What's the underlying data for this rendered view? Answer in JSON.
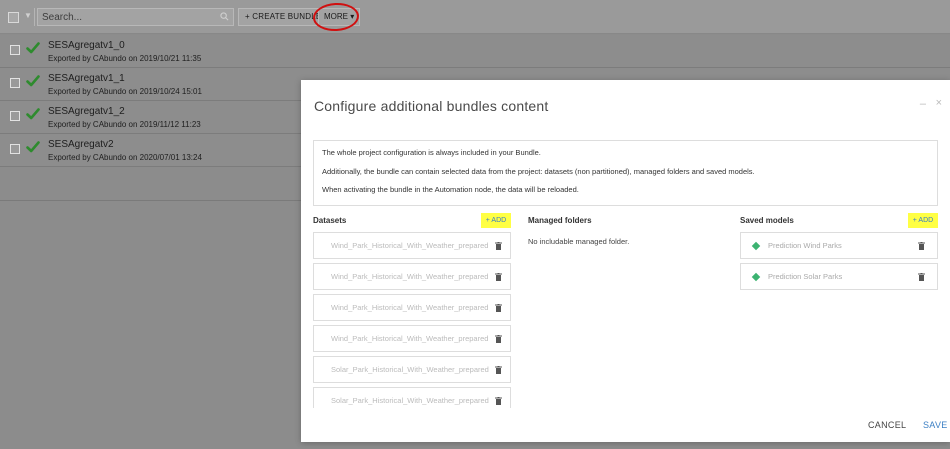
{
  "toolbar": {
    "search_placeholder": "Search...",
    "create_bundle_label": "+ CREATE BUNDLE",
    "more_label": "MORE ▾"
  },
  "bundles": [
    {
      "name": "SESAgregatv1_0",
      "exported": "Exported by CAbundo on 2019/10/21 11:35"
    },
    {
      "name": "SESAgregatv1_1",
      "exported": "Exported by CAbundo on 2019/10/24 15:01"
    },
    {
      "name": "SESAgregatv1_2",
      "exported": "Exported by CAbundo on 2019/11/12 11:23"
    },
    {
      "name": "SESAgregatv2",
      "exported": "Exported by CAbundo on 2020/07/01 13:24"
    }
  ],
  "modal": {
    "title": "Configure additional bundles content",
    "minimize": "–",
    "close": "×",
    "info": [
      "The whole project configuration is always included in your Bundle.",
      "Additionally, the bundle can contain selected data from the project: datasets (non partitioned), managed folders and saved models.",
      "When activating the bundle in the Automation node, the data will be reloaded."
    ],
    "datasets": {
      "header": "Datasets",
      "add_label": "+ ADD",
      "items": [
        "Wind_Park_Historical_With_Weather_prepared",
        "Wind_Park_Historical_With_Weather_prepared",
        "Wind_Park_Historical_With_Weather_prepared",
        "Wind_Park_Historical_With_Weather_prepared",
        "Solar_Park_Historical_With_Weather_prepared",
        "Solar_Park_Historical_With_Weather_prepared"
      ]
    },
    "managed_folders": {
      "header": "Managed folders",
      "empty_text": "No includable managed folder."
    },
    "saved_models": {
      "header": "Saved models",
      "add_label": "+ ADD",
      "items": [
        "Prediction Wind Parks",
        "Prediction Solar Parks"
      ]
    },
    "cancel_label": "CANCEL",
    "save_label": "SAVE"
  },
  "colors": {
    "accent": "#3b7fc4",
    "highlight": "#ffff44",
    "success": "#2e8b2e",
    "annotation": "#d01010"
  }
}
